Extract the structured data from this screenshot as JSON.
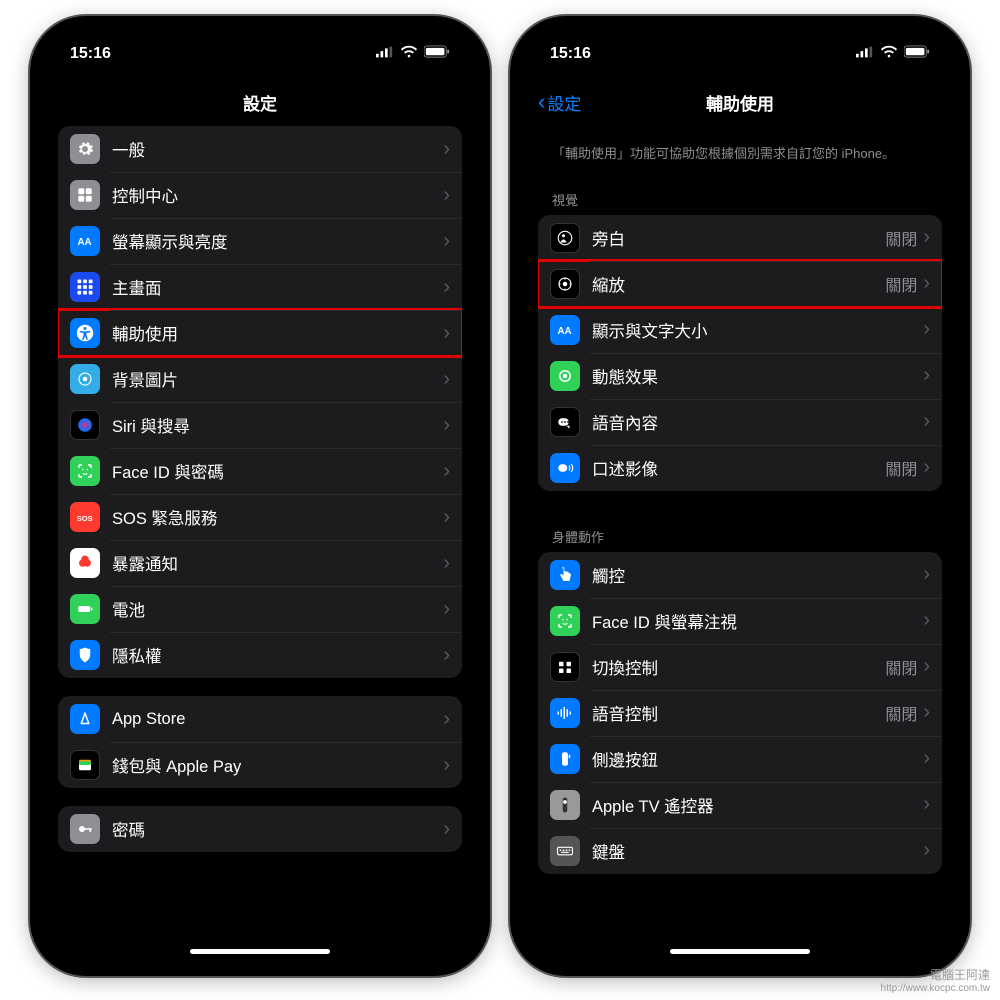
{
  "status": {
    "time": "15:16"
  },
  "left": {
    "title": "設定",
    "groups": [
      {
        "rows": [
          {
            "icon": "gear-icon",
            "bg": "bg-gray",
            "label": "一般"
          },
          {
            "icon": "control-center-icon",
            "bg": "bg-gray",
            "label": "控制中心"
          },
          {
            "icon": "display-icon",
            "bg": "bg-blue",
            "label": "螢幕顯示與亮度"
          },
          {
            "icon": "home-screen-icon",
            "bg": "bg-darkblue",
            "label": "主畫面"
          },
          {
            "icon": "accessibility-icon",
            "bg": "bg-blue",
            "label": "輔助使用",
            "highlight": true
          },
          {
            "icon": "wallpaper-icon",
            "bg": "bg-cyan",
            "label": "背景圖片"
          },
          {
            "icon": "siri-icon",
            "bg": "bg-black",
            "label": "Siri 與搜尋"
          },
          {
            "icon": "faceid-icon",
            "bg": "bg-green",
            "label": "Face ID 與密碼"
          },
          {
            "icon": "sos-icon",
            "bg": "bg-red",
            "label": "SOS 緊急服務"
          },
          {
            "icon": "exposure-icon",
            "bg": "bg-white",
            "label": "暴露通知"
          },
          {
            "icon": "battery-icon",
            "bg": "bg-green",
            "label": "電池"
          },
          {
            "icon": "privacy-icon",
            "bg": "bg-blue",
            "label": "隱私權"
          }
        ]
      },
      {
        "rows": [
          {
            "icon": "appstore-icon",
            "bg": "bg-blue",
            "label": "App Store"
          },
          {
            "icon": "wallet-icon",
            "bg": "bg-black",
            "label": "錢包與 Apple Pay"
          }
        ]
      },
      {
        "rows": [
          {
            "icon": "passwords-icon",
            "bg": "bg-gray",
            "label": "密碼"
          }
        ]
      }
    ]
  },
  "right": {
    "back": "設定",
    "title": "輔助使用",
    "description": "「輔助使用」功能可協助您根據個別需求自訂您的 iPhone。",
    "sections": [
      {
        "header": "視覺",
        "rows": [
          {
            "icon": "voiceover-icon",
            "bg": "bg-black",
            "label": "旁白",
            "value": "關閉"
          },
          {
            "icon": "zoom-icon",
            "bg": "bg-black",
            "label": "縮放",
            "value": "關閉",
            "highlight": true
          },
          {
            "icon": "textsize-icon",
            "bg": "bg-blue",
            "label": "顯示與文字大小"
          },
          {
            "icon": "motion-icon",
            "bg": "bg-green",
            "label": "動態效果"
          },
          {
            "icon": "spoken-icon",
            "bg": "bg-black",
            "label": "語音內容"
          },
          {
            "icon": "audiodesc-icon",
            "bg": "bg-blue",
            "label": "口述影像",
            "value": "關閉"
          }
        ]
      },
      {
        "header": "身體動作",
        "rows": [
          {
            "icon": "touch-icon",
            "bg": "bg-blue",
            "label": "觸控"
          },
          {
            "icon": "faceid-attn-icon",
            "bg": "bg-green",
            "label": "Face ID 與螢幕注視"
          },
          {
            "icon": "switch-icon",
            "bg": "bg-black",
            "label": "切換控制",
            "value": "關閉"
          },
          {
            "icon": "voicectrl-icon",
            "bg": "bg-blue",
            "label": "語音控制",
            "value": "關閉"
          },
          {
            "icon": "sidebtn-icon",
            "bg": "bg-blue",
            "label": "側邊按鈕"
          },
          {
            "icon": "appletv-icon",
            "bg": "bg-lgray",
            "label": "Apple TV 遙控器"
          },
          {
            "icon": "keyboard-icon",
            "bg": "bg-bgray",
            "label": "鍵盤"
          }
        ]
      }
    ]
  },
  "watermark": {
    "line1": "電腦王阿達",
    "line2": "http://www.kocpc.com.tw"
  }
}
